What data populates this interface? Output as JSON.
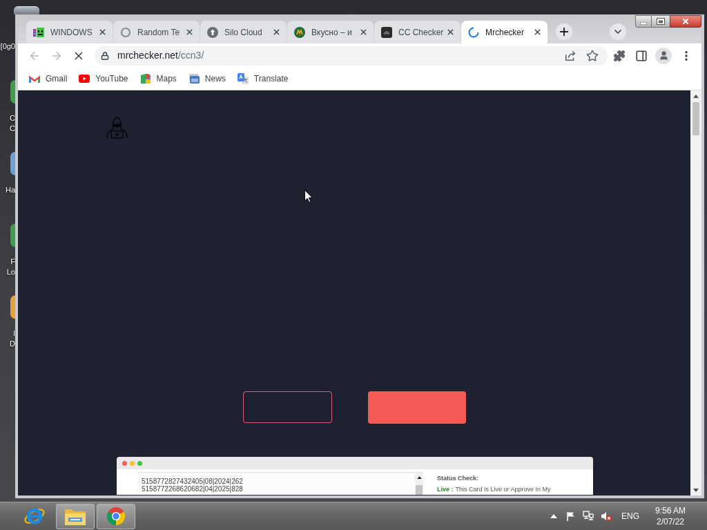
{
  "desktop": {
    "icons": [
      {
        "kind": "bin",
        "lines": [
          "[0g0"
        ]
      },
      {
        "kind": "shortcut",
        "color": "#3f9e4a",
        "lines": [
          "C",
          "C"
        ]
      },
      {
        "kind": "shortcut",
        "color": "#6d9fd6",
        "lines": [
          "Ha"
        ]
      },
      {
        "kind": "shortcut",
        "color": "#3f9e4a",
        "lines": [
          "F",
          "Lo"
        ]
      },
      {
        "kind": "shortcut",
        "color": "#e3a23a",
        "lines": [
          "I",
          "D"
        ]
      }
    ]
  },
  "browser": {
    "tabs": [
      {
        "title": "WINDOWS",
        "kind": "pixel",
        "selected": false
      },
      {
        "title": "Random Te",
        "kind": "ring",
        "selected": false
      },
      {
        "title": "Silo Cloud",
        "kind": "upload",
        "selected": false
      },
      {
        "title": "Вкусно – и",
        "kind": "round-logo",
        "selected": false
      },
      {
        "title": "CC Checker",
        "kind": "dark-tile",
        "selected": false
      },
      {
        "title": "Mrchecker",
        "kind": "spinner",
        "selected": true
      }
    ],
    "loading": true,
    "url_host": "mrchecker.net",
    "url_path": "/ccn3/",
    "bookmarks": [
      {
        "label": "Gmail",
        "kind": "mail"
      },
      {
        "label": "YouTube",
        "kind": "play"
      },
      {
        "label": "Maps",
        "kind": "map"
      },
      {
        "label": "News",
        "kind": "news"
      },
      {
        "label": "Translate",
        "kind": "translate"
      }
    ]
  },
  "page": {
    "buttons": [
      {
        "kind": "outline"
      },
      {
        "kind": "filled"
      }
    ],
    "preview": {
      "lines": [
        "5158772827432405|08|2024|262",
        "5158772268620682|04|2025|828"
      ],
      "status_title": "Status Check:",
      "status_label": "Live :",
      "status_text": "This Card Is Live or Approve In My"
    }
  },
  "taskbar": {
    "apps": [
      {
        "kind": "e-logo",
        "running": false
      },
      {
        "kind": "folder",
        "running": true
      },
      {
        "kind": "browser-logo",
        "running": true
      }
    ],
    "muted": true,
    "language": "ENG",
    "time": "9:56 AM",
    "date": "2/07/22"
  }
}
